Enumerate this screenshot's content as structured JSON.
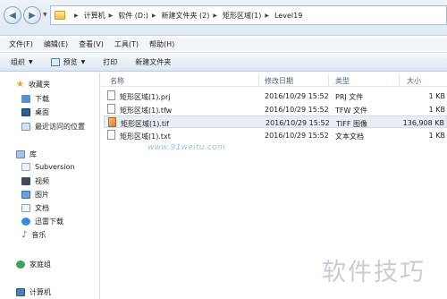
{
  "address": {
    "crumbs": [
      "计算机",
      "软件 (D:)",
      "新建文件夹 (2)",
      "矩形区域(1)",
      "Level19"
    ]
  },
  "menu": [
    "文件(F)",
    "编辑(E)",
    "查看(V)",
    "工具(T)",
    "帮助(H)"
  ],
  "toolbar": {
    "organize": "组织",
    "preview": "预览",
    "print": "打印",
    "new_folder": "新建文件夹"
  },
  "sidebar": {
    "favorites": "收藏夹",
    "downloads": "下载",
    "desktop": "桌面",
    "recent": "最近访问的位置",
    "libraries": "库",
    "subversion": "Subversion",
    "videos": "视频",
    "pictures": "图片",
    "documents": "文档",
    "thunder": "迅雷下载",
    "music": "音乐",
    "homegroup": "家庭组",
    "computer": "计算机"
  },
  "columns": {
    "name": "名称",
    "modified": "修改日期",
    "type": "类型",
    "size": "大小"
  },
  "files": [
    {
      "name": "矩形区域(1).prj",
      "date": "2016/10/29 15:52",
      "type": "PRJ 文件",
      "size": "1 KB"
    },
    {
      "name": "矩形区域(1).tfw",
      "date": "2016/10/29 15:52",
      "type": "TFW 文件",
      "size": "1 KB"
    },
    {
      "name": "矩形区域(1).tif",
      "date": "2016/10/29 15:52",
      "type": "TIFF 图像",
      "size": "136,908 KB"
    },
    {
      "name": "矩形区域(1).txt",
      "date": "2016/10/29 15:52",
      "type": "文本文档",
      "size": "1 KB"
    }
  ],
  "watermark": {
    "url": "www.91weitu.com",
    "text": "软件技巧"
  }
}
